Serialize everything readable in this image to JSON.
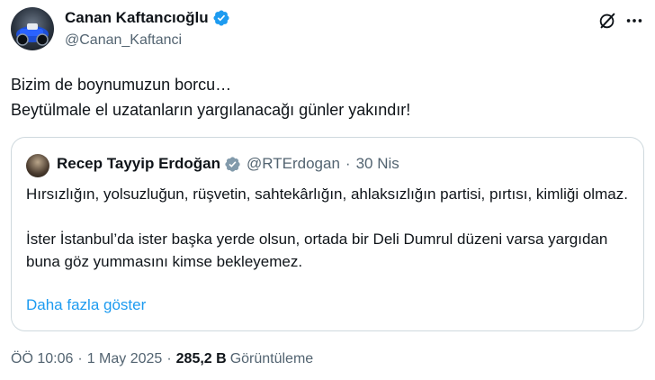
{
  "author": {
    "name": "Canan Kaftancıoğlu",
    "handle": "@Canan_Kaftanci"
  },
  "tweet": {
    "lines": [
      "Bizim de boynumuzun borcu…",
      "Beytülmale el uzatanların yargılanacağı günler yakındır!"
    ]
  },
  "quote": {
    "name": "Recep Tayyip Erdoğan",
    "handle": "@RTErdogan",
    "separator": "·",
    "date": "30 Nis",
    "paragraphs": [
      "Hırsızlığın, yolsuzluğun, rüşvetin, sahtekârlığın, ahlaksızlığın partisi, pırtısı, kimliği olmaz.",
      "İster İstanbul’da ister başka yerde olsun, ortada bir Deli Dumrul düzeni varsa yargıdan buna göz yummasını kimse bekleyemez."
    ],
    "show_more": "Daha fazla göster"
  },
  "meta": {
    "time": "ÖÖ 10:06",
    "date": "1 May 2025",
    "separator": "·",
    "views_count": "285,2 B",
    "views_label": "Görüntüleme"
  },
  "icons": {
    "verified": "verified-badge-icon",
    "grok": "grok-icon",
    "more": "more-icon"
  },
  "colors": {
    "verified": "#1d9bf0",
    "link": "#1d9bf0",
    "secondary_text": "#536471",
    "border": "#cfd9de"
  }
}
